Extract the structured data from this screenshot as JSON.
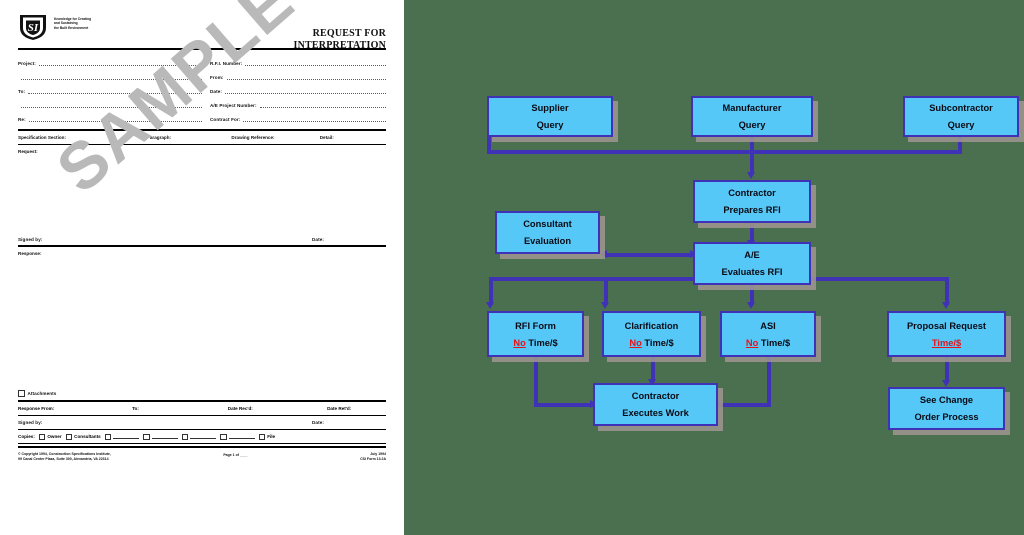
{
  "form": {
    "logo_tagline": "Knowledge for Creating\nand Sustaining\nthe Built Environment",
    "title_line1": "REQUEST FOR",
    "title_line2": "INTERPRETATION",
    "left_fields": [
      "Project:",
      "",
      "To:",
      "",
      "Re:"
    ],
    "right_fields": [
      "R.F.I. Number:",
      "From:",
      "Date:",
      "A/E Project Number:",
      "Contract For:"
    ],
    "spec_row": [
      "Specification Section:",
      "Paragraph:",
      "Drawing Reference:",
      "Detail:"
    ],
    "request_label": "Request:",
    "signed_by_label": "Signed by:",
    "date_label": "Date:",
    "response_label": "Response:",
    "attachments_label": "Attachments",
    "response_row": [
      "Response From:",
      "To:",
      "Date Rec'd:",
      "Date Ret'd:"
    ],
    "signed_by_label2": "Signed by:",
    "date_label2": "Date:",
    "copies_label": "Copies:",
    "copies_owner": "Owner",
    "copies_consultants": "Consultants",
    "copies_file": "File",
    "footer_left_line1": "© Copyright 1994, Construction Specifications Institute,",
    "footer_left_line2": "99 Canal Center Plaza, Suite 300, Alexandria, VA 22314",
    "footer_mid": "Page 1 of ____",
    "footer_right_line1": "July 1994",
    "footer_right_line2": "CSI Form 13.2A",
    "watermark": "SAMPLE"
  },
  "flowchart": {
    "colors": {
      "background": "#4a7050",
      "node_fill": "#55c8f7",
      "node_border": "#3f32b6",
      "connector": "#3f32b6",
      "emphasis": "#e8121a"
    },
    "nodes": [
      {
        "id": "supplier",
        "line1": "Supplier",
        "line2": "Query"
      },
      {
        "id": "manufacturer",
        "line1": "Manufacturer",
        "line2": "Query"
      },
      {
        "id": "subcontractor",
        "line1": "Subcontractor",
        "line2": "Query"
      },
      {
        "id": "contractor_prepares",
        "line1": "Contractor",
        "line2": "Prepares RFI"
      },
      {
        "id": "consultant",
        "line1": "Consultant",
        "line2": "Evaluation"
      },
      {
        "id": "ae",
        "line1": "A/E",
        "line2": "Evaluates RFI"
      },
      {
        "id": "rfi_form",
        "line1": "RFI Form",
        "line2_red": "No",
        "line2_rest": " Time/$"
      },
      {
        "id": "clarification",
        "line1": "Clarification",
        "line2_red": "No",
        "line2_rest": " Time/$"
      },
      {
        "id": "asi",
        "line1": "ASI",
        "line2_red": "No",
        "line2_rest": " Time/$"
      },
      {
        "id": "proposal",
        "line1": "Proposal Request",
        "line2_red": "Time/$",
        "line2_rest": ""
      },
      {
        "id": "contractor_executes",
        "line1": "Contractor",
        "line2": "Executes Work"
      },
      {
        "id": "change_order",
        "line1": "See Change",
        "line2": "Order Process"
      }
    ]
  }
}
